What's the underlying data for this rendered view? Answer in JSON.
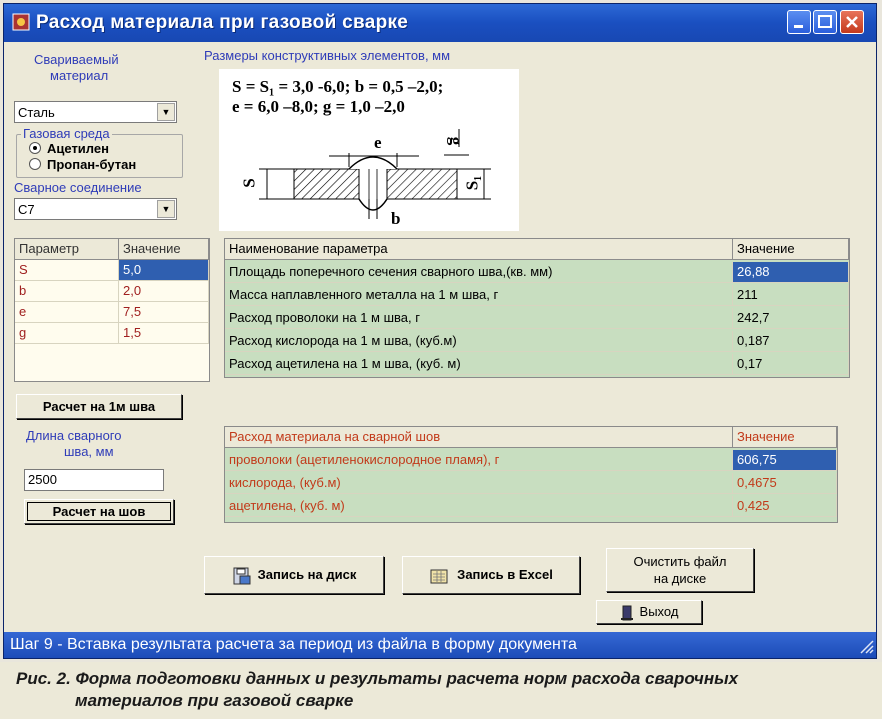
{
  "window": {
    "title": "Расход материала при газовой сварке"
  },
  "left_panel": {
    "material_label": "Свариваемый материал",
    "material_label_l1": "Свариваемый",
    "material_label_l2": "материал",
    "material_value": "Сталь",
    "gas_group_label": "Газовая среда",
    "gas_options": [
      {
        "label": "Ацетилен",
        "selected": true
      },
      {
        "label": "Пропан-бутан",
        "selected": false
      }
    ],
    "joint_label": "Сварное соединение",
    "joint_value": "С7"
  },
  "dimensions": {
    "label": "Размеры конструктивных элементов, мм",
    "formula_line1": "S = S₁ = 3,0 -6,0; b = 0,5 –2,0;",
    "formula_line2": "e = 6,0 –8,0; g = 1,0 –2,0",
    "diagram_labels": {
      "e": "e",
      "g": "g",
      "s": "S",
      "s1": "S₁",
      "b": "b"
    }
  },
  "param_table": {
    "headers": [
      "Параметр",
      "Значение"
    ],
    "rows": [
      {
        "name": "S",
        "value": "5,0"
      },
      {
        "name": "b",
        "value": "2,0"
      },
      {
        "name": "e",
        "value": "7,5"
      },
      {
        "name": "g",
        "value": "1,5"
      }
    ]
  },
  "results_table": {
    "headers": [
      "Наименование параметра",
      "Значение"
    ],
    "rows": [
      {
        "name": "Площадь поперечного сечения сварного шва,(кв. мм)",
        "value": "26,88"
      },
      {
        "name": "Масса наплавленного металла на 1 м шва, г",
        "value": "211"
      },
      {
        "name": "Расход проволоки на 1 м шва, г",
        "value": "242,7"
      },
      {
        "name": "Расход кислорода на 1 м шва, (куб.м)",
        "value": "0,187"
      },
      {
        "name": "Расход ацетилена на 1 м шва, (куб. м)",
        "value": "0,17"
      }
    ]
  },
  "seam": {
    "calc_per_meter_button": "Расчет на 1м шва",
    "length_label_l1": "Длина сварного",
    "length_label_l2": "шва, мм",
    "length_value": "2500",
    "calc_seam_button": "Расчет на шов"
  },
  "seam_table": {
    "headers": [
      "Расход материала на сварной шов",
      "Значение"
    ],
    "rows": [
      {
        "name": "проволоки (ацетиленокислородное пламя), г",
        "value": "606,75"
      },
      {
        "name": "кислорода, (куб.м)",
        "value": "0,4675"
      },
      {
        "name": "ацетилена, (куб. м)",
        "value": "0,425"
      }
    ]
  },
  "buttons": {
    "save_disk": "Запись на диск",
    "save_excel": "Запись в Excel",
    "clear_file_l1": "Очистить файл",
    "clear_file_l2": "на диске",
    "exit": "Выход"
  },
  "statusbar": {
    "text": "Шаг 9 - Вставка результата расчета за период из файла в форму документа"
  },
  "caption": {
    "line1": "Рис. 2. Форма подготовки данных и результаты расчета норм расхода сварочных",
    "line2": "материалов при газовой сварке"
  },
  "colors": {
    "title_bar": "#1a4fc0",
    "label_blue": "#2f3cb8",
    "grid_green": "#c8dec0",
    "selection": "#2f5fb0",
    "seam_text": "#c23a1a"
  },
  "icons": [
    "app-icon",
    "minimize-icon",
    "maximize-icon",
    "close-icon",
    "disk-save-icon",
    "excel-icon",
    "exit-door-icon",
    "resize-grip-icon"
  ]
}
